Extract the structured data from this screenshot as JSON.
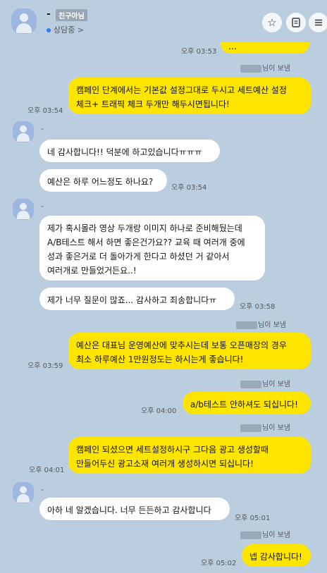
{
  "header": {
    "name": "-",
    "badge": "친구아님",
    "status": "상담중",
    "status_chevron": ">",
    "star_icon": "star-icon",
    "list_icon": "document-icon",
    "menu_icon": "hamburger-icon"
  },
  "messages": {
    "m0": {
      "text": "…",
      "time": "오후 03:53"
    },
    "s1": {
      "suffix": "님이 보냄"
    },
    "m1": {
      "text": "캠페인 단계에서는 기본값 설정그대로 두시고 세트예산 설정 체크+ 트래픽 체크 두개만 해두시면됩니다!",
      "time": "오후 03:54"
    },
    "g1_name": "-",
    "m2": {
      "text": "네 감사합니다!! 덕분에 하고있습니다ㅠㅠㅠ"
    },
    "m3": {
      "text": "예산은 하루 어느정도 하나요?",
      "time": "오후 03:54"
    },
    "g2_name": "-",
    "m4": {
      "text": "제가 혹시몰라 영상 두개랑 이미지 하나로 준비해뒀는데 A/B테스트 해서 하면 좋은건가요?? 교육 때 여러개 중에 성과 좋은거로 더 돌아가게 한다고 하셨던 거 같아서 여러개로 만들었거든요..!"
    },
    "m5": {
      "text": "제가 너무 질문이 많죠... 감사하고 죄송합니다ㅠ",
      "time": "오후 03:58"
    },
    "s2": {
      "suffix": "님이 보냄"
    },
    "m6": {
      "text": "예산은 대표님 운영예산에 맞추시는데 보통 오픈매장의 경우 최소 하루예산 1만원정도는 하시는게 좋습니다!",
      "time": "오후 03:59"
    },
    "s3": {
      "suffix": "님이 보냄"
    },
    "m7": {
      "text": "a/b테스트 안하셔도 되십니다!",
      "time": "오후 04:00"
    },
    "s4": {
      "suffix": "님이 보냄"
    },
    "m8": {
      "text": "캠페인 되셨으면 세트설정하시구 그다음 광고 생성할때 만들어두신 광고소재 여러개 생성하시면 되십니다!",
      "time": "오후 04:01"
    },
    "g3_name": "-",
    "m9": {
      "text": "아하 네 알겠습니다. 너무 든든하고 감사합니다",
      "time": "오후 05:01"
    },
    "s5": {
      "suffix": "님이 보냄"
    },
    "m10": {
      "text": "넵 감사합니다!",
      "time": "오후 05:02"
    }
  },
  "colors": {
    "background": "#bacee0",
    "my_bubble": "#fee500",
    "their_bubble": "#ffffff"
  }
}
